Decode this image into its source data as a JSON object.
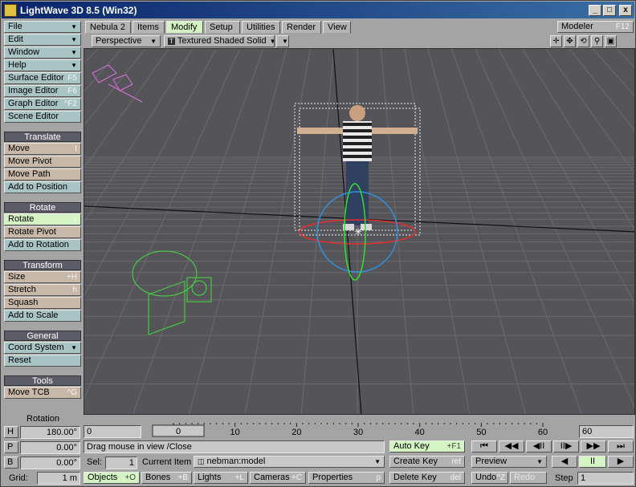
{
  "window": {
    "title": "LightWave 3D 8.5 (Win32)",
    "minimize": "_",
    "maximize": "□",
    "close": "x"
  },
  "menus": [
    {
      "label": "File",
      "sc": ""
    },
    {
      "label": "Edit",
      "sc": ""
    },
    {
      "label": "Window",
      "sc": ""
    },
    {
      "label": "Help",
      "sc": ""
    }
  ],
  "editors": [
    {
      "label": "Surface Editor",
      "sc": "F5"
    },
    {
      "label": "Image Editor",
      "sc": "F6"
    },
    {
      "label": "Graph Editor",
      "sc": "^F2"
    },
    {
      "label": "Scene Editor",
      "sc": ""
    }
  ],
  "sections": {
    "translate": {
      "title": "Translate",
      "items": [
        {
          "label": "Move",
          "sc": "t"
        },
        {
          "label": "Move Pivot",
          "sc": ""
        },
        {
          "label": "Move Path",
          "sc": ""
        },
        {
          "label": "Add to Position",
          "sc": ""
        }
      ]
    },
    "rotate": {
      "title": "Rotate",
      "items": [
        {
          "label": "Rotate",
          "sc": "y"
        },
        {
          "label": "Rotate Pivot",
          "sc": ""
        },
        {
          "label": "Add to Rotation",
          "sc": ""
        }
      ]
    },
    "transform": {
      "title": "Transform",
      "items": [
        {
          "label": "Size",
          "sc": "+H"
        },
        {
          "label": "Stretch",
          "sc": "h"
        },
        {
          "label": "Squash",
          "sc": ""
        },
        {
          "label": "Add to Scale",
          "sc": ""
        }
      ]
    },
    "general": {
      "title": "General",
      "items": [
        {
          "label": "Coord System",
          "sc": ""
        },
        {
          "label": "Reset",
          "sc": ""
        }
      ]
    },
    "tools": {
      "title": "Tools",
      "items": [
        {
          "label": "Move TCB",
          "sc": "^G"
        }
      ]
    }
  },
  "tabs": [
    "Nebula 2",
    "Items",
    "Modify",
    "Setup",
    "Utilities",
    "Render",
    "View"
  ],
  "modeler": {
    "label": "Modeler",
    "sc": "F12"
  },
  "viewport_bar": {
    "view": "Perspective",
    "render_mode": "Textured Shaded Solid",
    "render_icon": "T"
  },
  "rotation": {
    "title": "Rotation",
    "h_label": "H",
    "h_value": "180.00°",
    "p_label": "P",
    "p_value": "0.00°",
    "b_label": "B",
    "b_value": "0.00°"
  },
  "grid": {
    "label": "Grid:",
    "value": "1 m"
  },
  "timeline": {
    "start": "0",
    "end": "60",
    "current": "0",
    "ticks": [
      "0",
      "10",
      "20",
      "30",
      "40",
      "50",
      "60"
    ]
  },
  "status": {
    "message": "Drag mouse in view /Close"
  },
  "sel": {
    "label": "Sel:",
    "value": "1"
  },
  "current_item": {
    "label": "Current Item",
    "value": "nebman:model"
  },
  "filters": [
    {
      "label": "Objects",
      "sc": "+O"
    },
    {
      "label": "Bones",
      "sc": "+B"
    },
    {
      "label": "Lights",
      "sc": "+L"
    },
    {
      "label": "Cameras",
      "sc": "+C"
    }
  ],
  "properties": {
    "label": "Properties",
    "sc": "p"
  },
  "keys": {
    "auto": {
      "label": "Auto Key",
      "sc": "+F1"
    },
    "create": {
      "label": "Create Key",
      "sc": "ret"
    },
    "delete": {
      "label": "Delete Key",
      "sc": "del"
    }
  },
  "preview": "Preview",
  "undo": {
    "label": "Undo",
    "sc": "^Z"
  },
  "redo": "Redo",
  "step": {
    "label": "Step",
    "value": "1"
  },
  "playback": {
    "first": "⏮",
    "prev_key": "◀◀",
    "prev_frame": "◀II",
    "next_frame": "II▶",
    "next_key": "▶▶",
    "last": "⏭",
    "rev": "◀",
    "pause": "II",
    "play": "▶"
  },
  "colors": {
    "viewport": "#555559",
    "grid": "#6a6a70",
    "active": "#d4f4c4",
    "camera": "#e070e0",
    "light": "#40e040"
  }
}
